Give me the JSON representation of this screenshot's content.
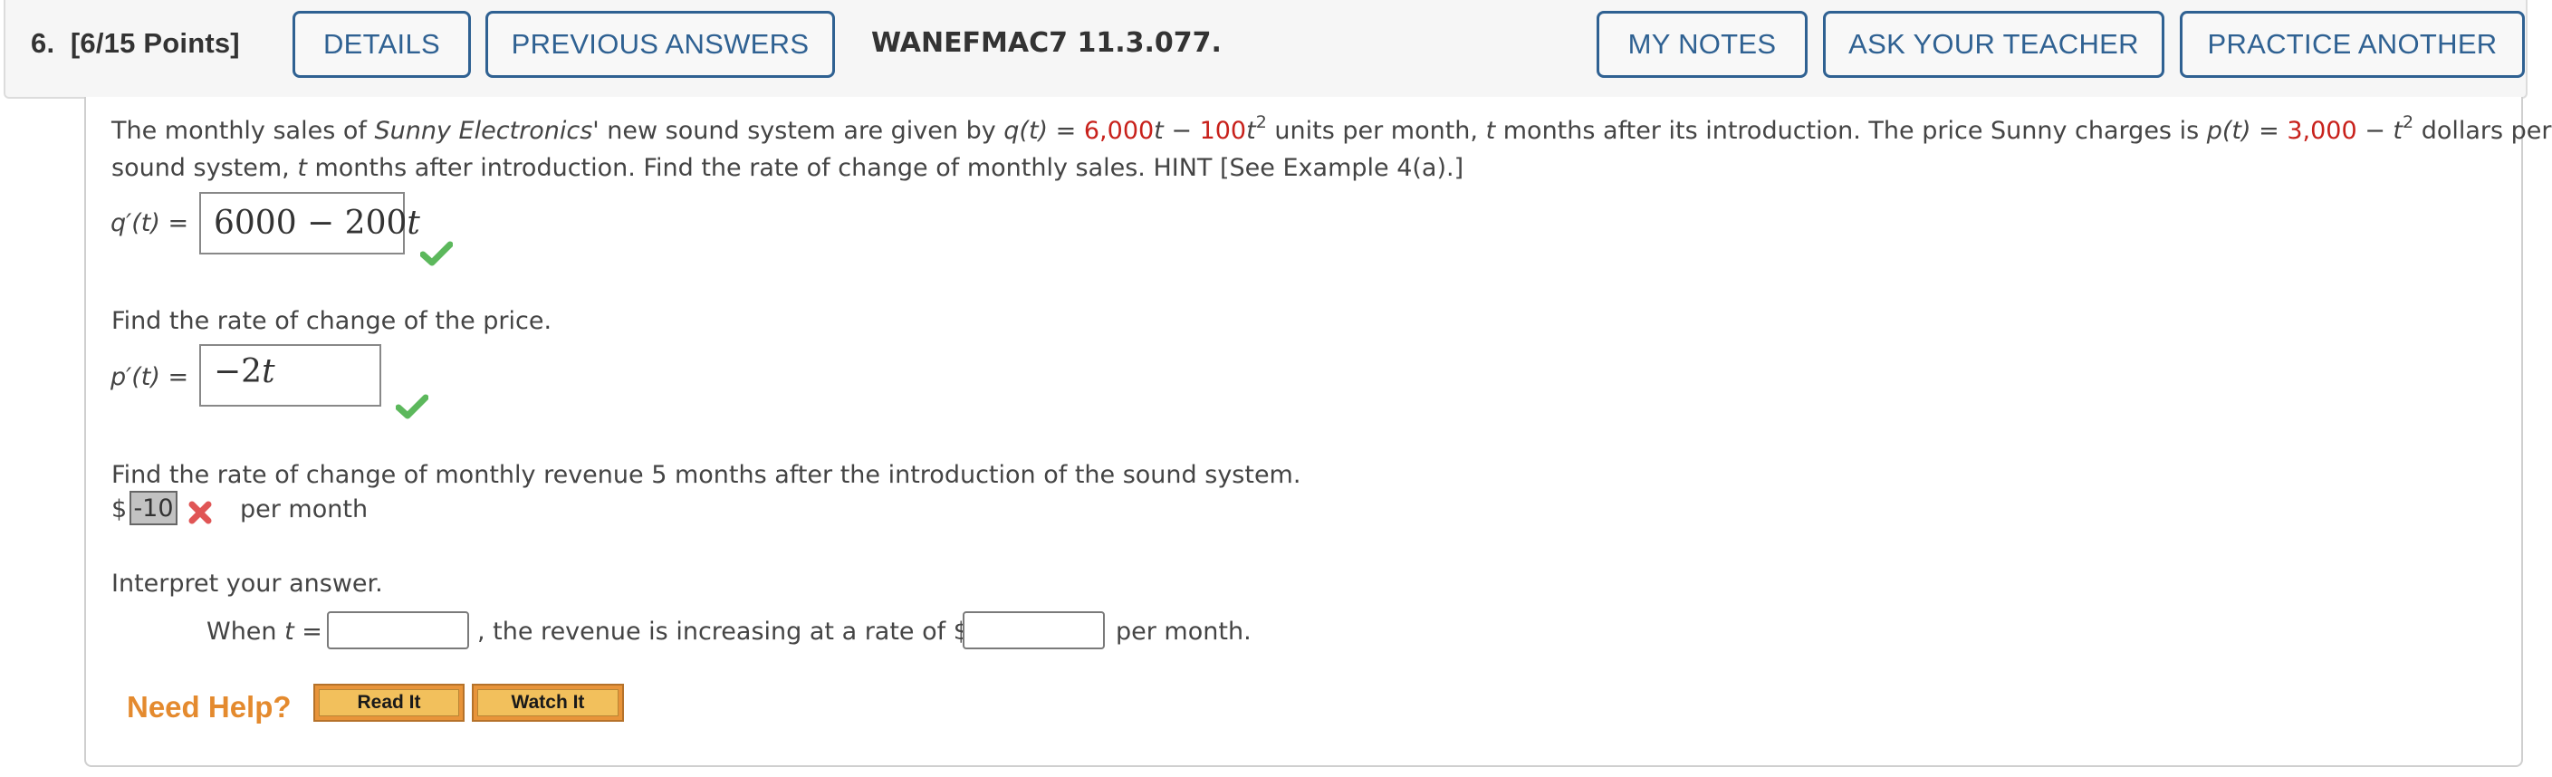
{
  "header": {
    "question_number": "6.",
    "points": "[6/15 Points]",
    "buttons": {
      "details": "DETAILS",
      "previous_answers": "PREVIOUS ANSWERS",
      "my_notes": "MY NOTES",
      "ask_teacher": "ASK YOUR TEACHER",
      "practice_another": "PRACTICE ANOTHER"
    },
    "question_id": "WANEFMAC7 11.3.077."
  },
  "problem": {
    "p1": "The monthly sales of ",
    "company": "Sunny Electronics'",
    "p2": " new sound system are given by ",
    "q_fn": "q(t)",
    "eq": " = ",
    "q_coef1": "6,000",
    "t": "t",
    "minus": " − ",
    "q_coef2": "100",
    "sq": "2",
    "p3": " units per month, ",
    "p4": " months after its introduction. The price Sunny charges is ",
    "p_fn": "p(t)",
    "p_const": "3,000",
    "p5": " dollars per",
    "line2a": "sound system, ",
    "line2b": " months after introduction. Find the rate of change of monthly sales. HINT [See Example 4(a).]"
  },
  "part1": {
    "label": "q′(t) = ",
    "answer_num": "6000 − 200",
    "answer_var": "t",
    "status": "correct"
  },
  "part2": {
    "prompt": "Find the rate of change of the price.",
    "label": "p′(t) = ",
    "answer_num": "−2",
    "answer_var": "t",
    "status": "correct"
  },
  "part3": {
    "prompt": "Find the rate of change of monthly revenue 5 months after the introduction of the sound system.",
    "currency": "$",
    "answer": "-10",
    "status": "incorrect",
    "unit": "per month"
  },
  "part4": {
    "prompt": "Interpret your answer.",
    "when": "When ",
    "t": "t",
    "eq": " =",
    "middle": ", the revenue is increasing at a rate of $",
    "t_value": "",
    "rate_value": "",
    "unit": "per month."
  },
  "help": {
    "label": "Need Help?",
    "read_it": "Read It",
    "watch_it": "Watch It"
  },
  "colors": {
    "accent": "#2f6192",
    "highlight_red": "#c8211b",
    "correct_green": "#5cb85c",
    "incorrect_red": "#e05555",
    "help_orange": "#e48a2e"
  }
}
